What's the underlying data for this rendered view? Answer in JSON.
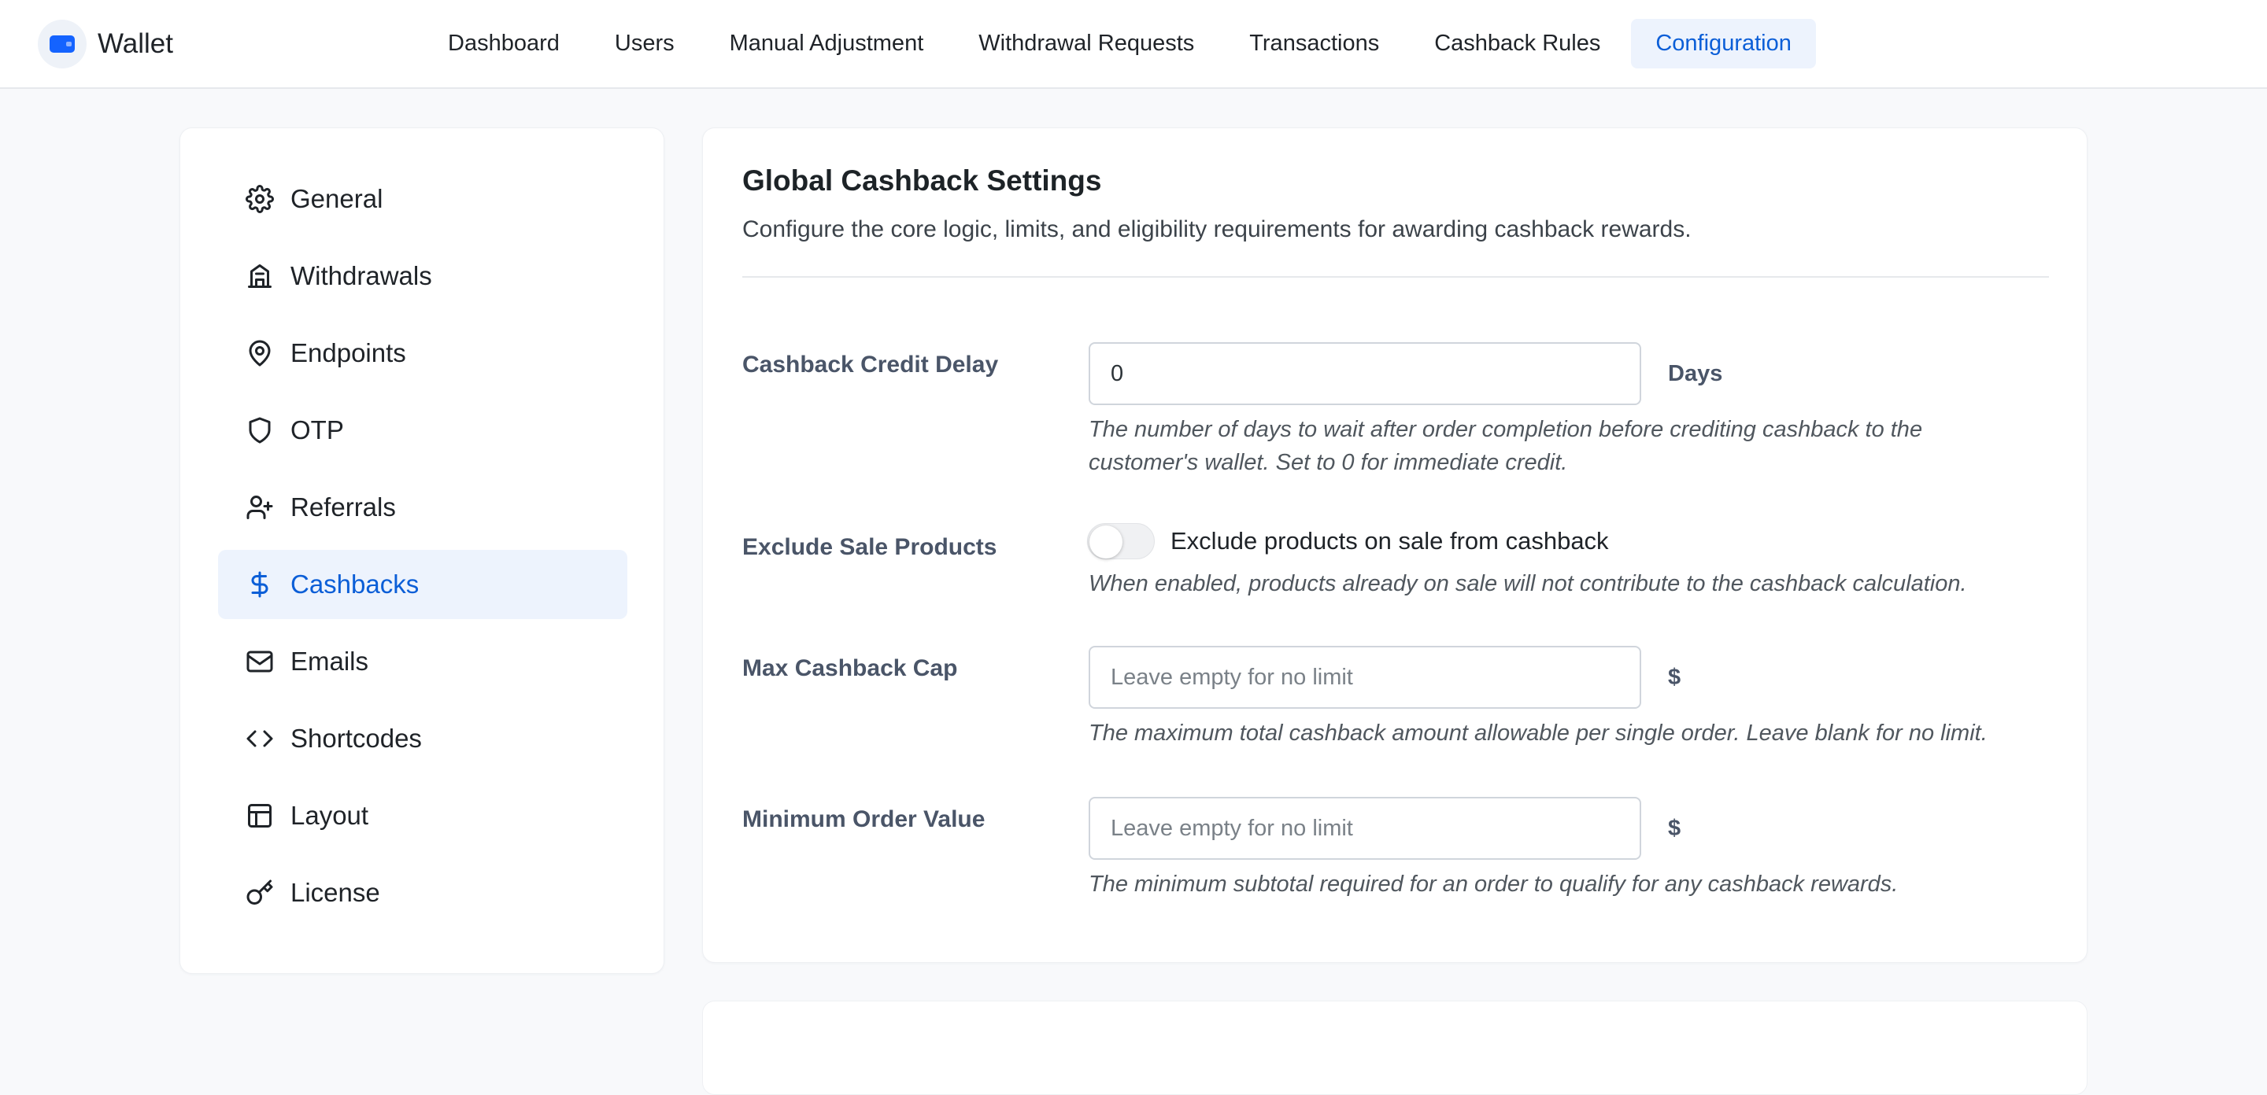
{
  "app": {
    "name": "Wallet"
  },
  "topnav": [
    {
      "label": "Dashboard",
      "active": false
    },
    {
      "label": "Users",
      "active": false
    },
    {
      "label": "Manual Adjustment",
      "active": false
    },
    {
      "label": "Withdrawal Requests",
      "active": false
    },
    {
      "label": "Transactions",
      "active": false
    },
    {
      "label": "Cashback Rules",
      "active": false
    },
    {
      "label": "Configuration",
      "active": true
    }
  ],
  "sidebar": {
    "items": [
      {
        "label": "General",
        "icon": "gear-icon"
      },
      {
        "label": "Withdrawals",
        "icon": "bank-icon"
      },
      {
        "label": "Endpoints",
        "icon": "map-pin-icon"
      },
      {
        "label": "OTP",
        "icon": "shield-icon"
      },
      {
        "label": "Referrals",
        "icon": "user-plus-icon"
      },
      {
        "label": "Cashbacks",
        "icon": "dollar-icon",
        "active": true
      },
      {
        "label": "Emails",
        "icon": "mail-icon"
      },
      {
        "label": "Shortcodes",
        "icon": "code-icon"
      },
      {
        "label": "Layout",
        "icon": "layout-icon"
      },
      {
        "label": "License",
        "icon": "key-icon"
      }
    ]
  },
  "settings": {
    "title": "Global Cashback Settings",
    "description": "Configure the core logic, limits, and eligibility requirements for awarding cashback rewards.",
    "credit_delay": {
      "label": "Cashback Credit Delay",
      "value": "0",
      "suffix": "Days",
      "help_line1": "The number of days to wait after order completion before crediting cashback to the",
      "help_line2": "customer's wallet. Set to 0 for immediate credit."
    },
    "exclude_sale": {
      "label": "Exclude Sale Products",
      "toggle_label": "Exclude products on sale from cashback",
      "enabled": false,
      "help": "When enabled, products already on sale will not contribute to the cashback calculation."
    },
    "max_cap": {
      "label": "Max Cashback Cap",
      "value": "",
      "placeholder": "Leave empty for no limit",
      "suffix": "$",
      "help": "The maximum total cashback amount allowable per single order. Leave blank for no limit."
    },
    "min_order": {
      "label": "Minimum Order Value",
      "value": "",
      "placeholder": "Leave empty for no limit",
      "suffix": "$",
      "help": "The minimum subtotal required for an order to qualify for any cashback rewards."
    }
  },
  "colors": {
    "accent": "#0b5ed7",
    "brand": "#1463ff",
    "active_bg": "#edf3fd"
  }
}
